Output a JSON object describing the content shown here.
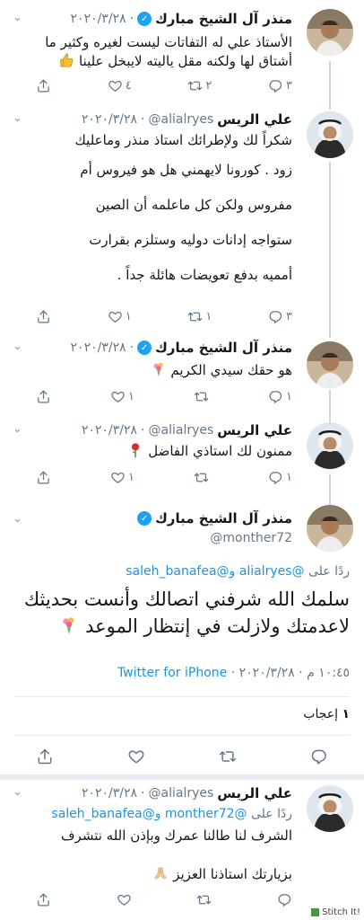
{
  "tweets": [
    {
      "name": "منذر آل الشيخ مبارك",
      "verified": true,
      "date": "٢٠٢٠/٣/٢٨",
      "lines": [
        "الأستاذ علي له التفاتات ليست لغيره وكثير ما",
        "أشتاق لها ولكنه مقل ياليته لايبخل علينا"
      ],
      "counts": {
        "reply": "٣",
        "retweet": "٢",
        "like": "٤"
      }
    },
    {
      "name": "علي الريس",
      "handle": "@alialryes",
      "date": "٢٠٢٠/٣/٢٨",
      "lines": [
        "شكراً لك ولإطرائك استاذ منذر وماعليك",
        "زود . كورونا لايهمني هل هو فيروس أم",
        "مفروس ولكن كل ماعلمه أن الصين",
        "ستواجه إدانات دوليه وستلزم بقرارت",
        "أمميه بدفع تعويضات هائلة جداً ."
      ],
      "counts": {
        "reply": "٣",
        "retweet": "١",
        "like": "١"
      }
    },
    {
      "name": "منذر آل الشيخ مبارك",
      "verified": true,
      "date": "٢٠٢٠/٣/٢٨",
      "lines": [
        "هو حقك سيدي الكريم"
      ],
      "counts": {
        "reply": "١",
        "retweet": "",
        "like": "١"
      }
    },
    {
      "name": "علي الريس",
      "handle": "@alialryes",
      "date": "٢٠٢٠/٣/٢٨",
      "lines": [
        "ممنون لك استاذي الفاضل"
      ],
      "counts": {
        "reply": "١",
        "retweet": "",
        "like": "١"
      }
    }
  ],
  "focused": {
    "name": "منذر آل الشيخ مبارك",
    "handle": "@monther72",
    "reply_prefix": "ردًا على",
    "reply_handles": "@alialryes",
    "reply_and": "و",
    "reply_handle2": "@saleh_banafea",
    "text_lines": [
      "سلمك الله شرفني اتصالك وأنست بحديثك",
      "لاعدمتك ولازلت في إنتظار الموعد"
    ],
    "time": "١٠:٤٥ م",
    "date": "٢٠٢٠/٣/٢٨",
    "source": "Twitter for iPhone",
    "likes_count": "١",
    "likes_label": "إعجاب"
  },
  "reply": {
    "name": "علي الريس",
    "handle": "@alialryes",
    "date": "٢٠٢٠/٣/٢٨",
    "reply_prefix": "ردًا على",
    "reply_handle1": "@monther72",
    "reply_and": "و",
    "reply_handle2": "@saleh_banafea",
    "lines": [
      "الشرف لنا طالنا عمرك وبإذن الله نتشرف",
      "بزيارتك استاذنا العزيز"
    ],
    "counts": {
      "reply": "",
      "retweet": "",
      "like": ""
    }
  },
  "watermark": "Stitch It!",
  "icons": [
    "reply-icon",
    "retweet-icon",
    "like-icon",
    "share-icon",
    "verified-icon",
    "chevron-down-icon"
  ],
  "colors": {
    "accent": "#1da1f2",
    "link": "#1b95e0",
    "muted": "#657786"
  }
}
